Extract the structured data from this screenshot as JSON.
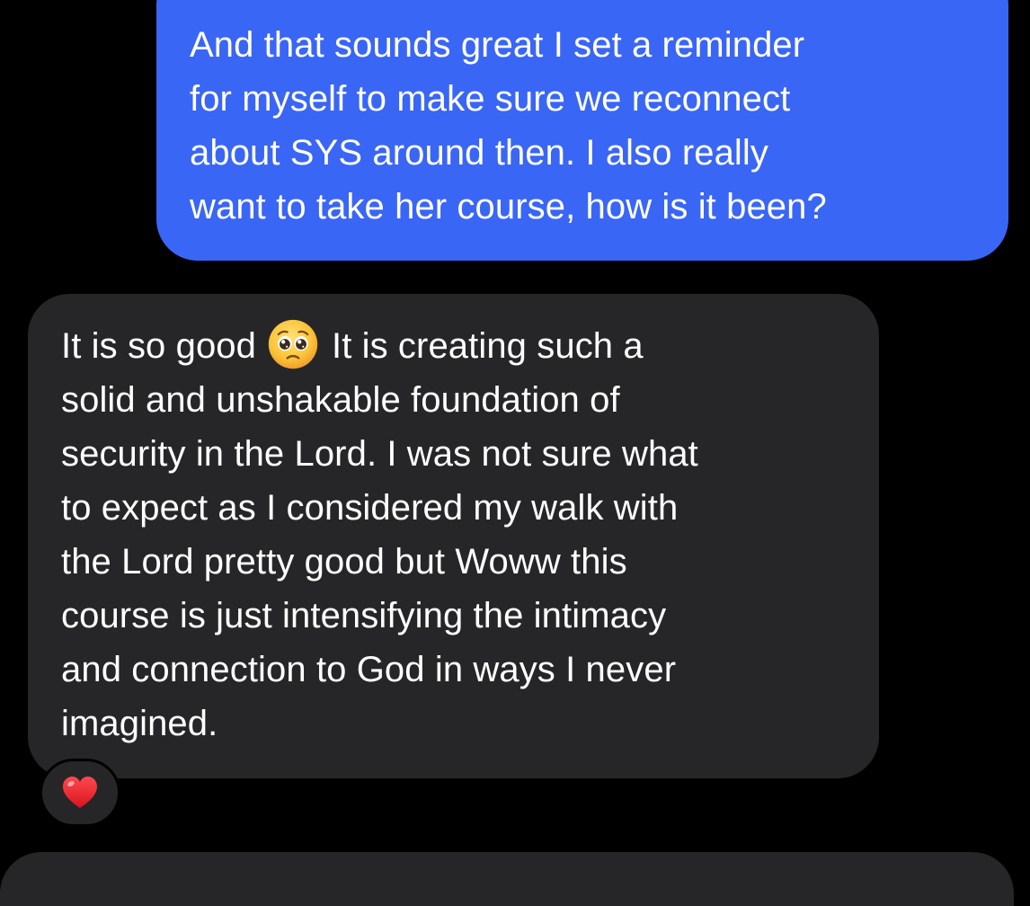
{
  "colors": {
    "background": "#000000",
    "outgoing_bubble": "#3a66f5",
    "incoming_bubble": "#262628",
    "text": "#ffffff",
    "reaction_heart": "#e8232d"
  },
  "messages": [
    {
      "direction": "outgoing",
      "lines": [
        "And that sounds great I set a reminder",
        "for myself to make sure we reconnect",
        "about SYS around then. I also really",
        "want to take her course, how is it been?"
      ]
    },
    {
      "direction": "incoming",
      "first_line_before_emoji": "It is so good",
      "inline_emoji": "pleading-face-emoji",
      "first_line_after_emoji": "It is creating such a",
      "lines": [
        "solid and unshakable foundation of",
        "security in the Lord. I was not sure what",
        "to expect as I considered my walk with",
        "the Lord pretty good but Woww this",
        "course is just intensifying the intimacy",
        "and connection to God in ways I never",
        "imagined."
      ],
      "reaction": "red-heart-icon"
    }
  ]
}
